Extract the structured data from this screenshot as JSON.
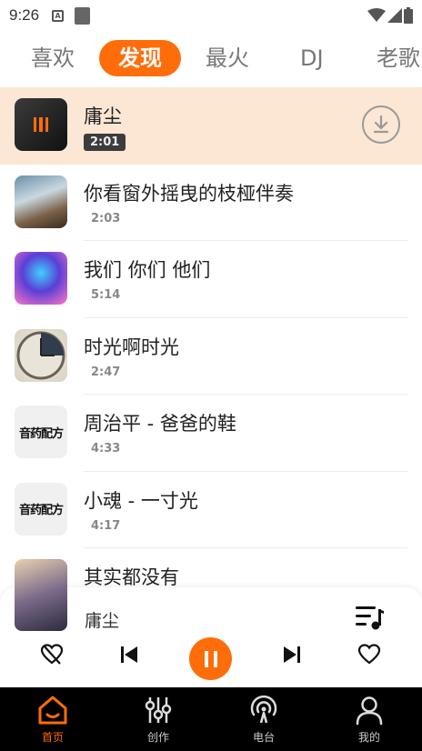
{
  "status_bar": {
    "time": "9:26",
    "notification_icon_letter": "A",
    "icons": [
      "notification-a-icon",
      "app-square-icon",
      "wifi-icon",
      "signal-icon",
      "battery-icon"
    ]
  },
  "tabs": [
    {
      "label": "喜欢",
      "active": false
    },
    {
      "label": "发现",
      "active": true
    },
    {
      "label": "最火",
      "active": false
    },
    {
      "label": "DJ",
      "active": false
    },
    {
      "label": "老歌",
      "active": false
    }
  ],
  "songs": [
    {
      "title": "庸尘",
      "duration": "2:01",
      "playing": true,
      "cover": "dark-portrait"
    },
    {
      "title": "你看窗外摇曳的枝桠伴奏",
      "duration": "2:03",
      "playing": false,
      "cover": "window-room"
    },
    {
      "title": "我们 你们 他们",
      "duration": "5:14",
      "playing": false,
      "cover": "neon-figure"
    },
    {
      "title": "时光啊时光",
      "duration": "2:47",
      "playing": false,
      "cover": "clock"
    },
    {
      "title": "周治平 - 爸爸的鞋",
      "duration": "4:33",
      "playing": false,
      "cover": "logo"
    },
    {
      "title": "小魂 - 一寸光",
      "duration": "4:17",
      "playing": false,
      "cover": "logo"
    },
    {
      "title": "其实都没有",
      "duration": "",
      "playing": false,
      "cover": "anime-girl"
    }
  ],
  "cover_logo_text": "音药配方",
  "mini_player": {
    "title": "庸尘",
    "state": "playing",
    "controls": [
      "dislike-icon",
      "previous-icon",
      "pause-icon",
      "next-icon",
      "like-heart-icon"
    ]
  },
  "bottom_nav": [
    {
      "label": "首页",
      "icon": "home-icon",
      "active": true
    },
    {
      "label": "创作",
      "icon": "sliders-icon",
      "active": false
    },
    {
      "label": "电台",
      "icon": "radio-icon",
      "active": false
    },
    {
      "label": "我的",
      "icon": "user-icon",
      "active": false
    }
  ],
  "colors": {
    "accent": "#fe6d09",
    "playing_row": "#fbe7d4",
    "nav_bg": "#000000"
  }
}
